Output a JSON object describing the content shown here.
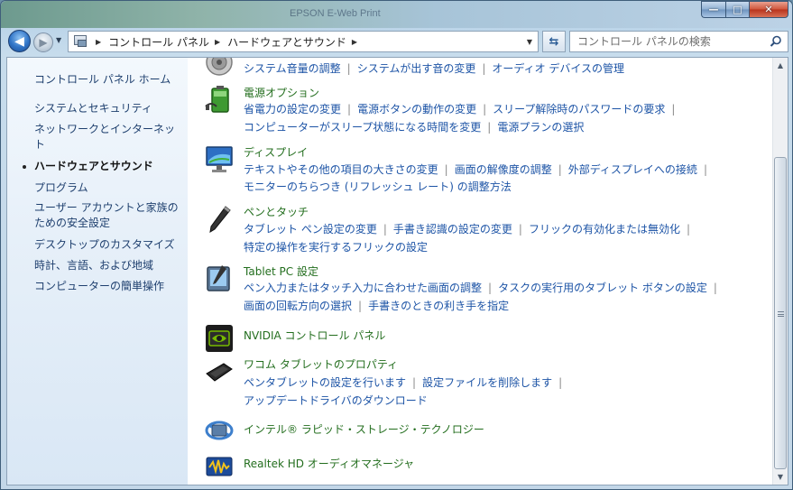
{
  "titlebar": {
    "bg_text": "EPSON  E-Web Print",
    "min_label": "—",
    "max_label": "□",
    "close_label": "✕"
  },
  "nav": {
    "back": "◀",
    "forward": "▶",
    "history": "▼",
    "refresh": "⇆",
    "breadcrumb": [
      "コントロール パネル",
      "ハードウェアとサウンド"
    ],
    "search_placeholder": "コントロール パネルの検索"
  },
  "sidebar": {
    "items": [
      {
        "label": "コントロール パネル ホーム",
        "active": false
      },
      {
        "label": "システムとセキュリティ",
        "active": false
      },
      {
        "label": "ネットワークとインターネット",
        "active": false
      },
      {
        "label": "ハードウェアとサウンド",
        "active": true
      },
      {
        "label": "プログラム",
        "active": false
      },
      {
        "label": "ユーザー アカウントと家族のための安全設定",
        "active": false
      },
      {
        "label": "デスクトップのカスタマイズ",
        "active": false
      },
      {
        "label": "時計、言語、および地域",
        "active": false
      },
      {
        "label": "コンピューターの簡単操作",
        "active": false
      }
    ]
  },
  "categories": [
    {
      "id": "sound",
      "icon": "speaker-icon",
      "title": "",
      "rows": [
        [
          "システム音量の調整",
          "システムが出す音の変更",
          "オーディオ デバイスの管理"
        ]
      ]
    },
    {
      "id": "power",
      "icon": "battery-icon",
      "title": "電源オプション",
      "rows": [
        [
          "省電力の設定の変更",
          "電源ボタンの動作の変更",
          "スリープ解除時のパスワードの要求"
        ],
        [
          "コンピューターがスリープ状態になる時間を変更",
          "電源プランの選択"
        ]
      ]
    },
    {
      "id": "display",
      "icon": "monitor-icon",
      "title": "ディスプレイ",
      "rows": [
        [
          "テキストやその他の項目の大きさの変更",
          "画面の解像度の調整",
          "外部ディスプレイへの接続"
        ],
        [
          "モニターのちらつき (リフレッシュ レート) の調整方法"
        ]
      ]
    },
    {
      "id": "pen",
      "icon": "pen-icon",
      "title": "ペンとタッチ",
      "rows": [
        [
          "タブレット ペン設定の変更",
          "手書き認識の設定の変更",
          "フリックの有効化または無効化"
        ],
        [
          "特定の操作を実行するフリックの設定"
        ]
      ]
    },
    {
      "id": "tablet",
      "icon": "tablet-pc-icon",
      "title": "Tablet PC 設定",
      "rows": [
        [
          "ペン入力またはタッチ入力に合わせた画面の調整",
          "タスクの実行用のタブレット ボタンの設定"
        ],
        [
          "画面の回転方向の選択",
          "手書きのときの利き手を指定"
        ]
      ]
    },
    {
      "id": "nvidia",
      "icon": "nvidia-icon",
      "title": "NVIDIA コントロール パネル",
      "rows": []
    },
    {
      "id": "wacom",
      "icon": "wacom-tablet-icon",
      "title": "ワコム タブレットのプロパティ",
      "rows": [
        [
          "ペンタブレットの設定を行います",
          "設定ファイルを削除します"
        ],
        [
          "アップデートドライバのダウンロード"
        ]
      ]
    },
    {
      "id": "intel",
      "icon": "intel-storage-icon",
      "title": "インテル® ラピッド・ストレージ・テクノロジー",
      "rows": []
    },
    {
      "id": "realtek",
      "icon": "realtek-audio-icon",
      "title": "Realtek HD オーディオマネージャ",
      "rows": []
    }
  ],
  "colors": {
    "link": "#1d54a6",
    "category_title": "#236e1e",
    "sidebar_link": "#1e3f6e"
  }
}
